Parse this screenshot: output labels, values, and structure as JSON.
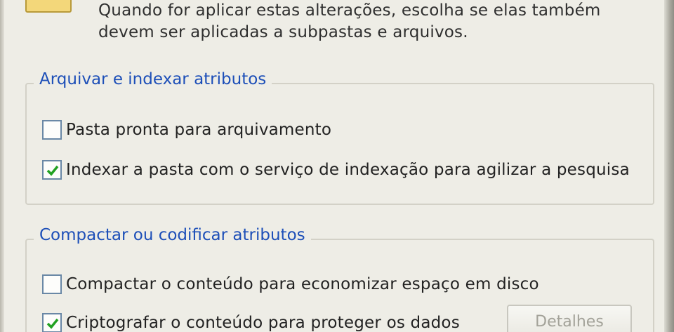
{
  "intro": {
    "line1": "Quando for aplicar estas alterações, escolha se elas também",
    "line2": "devem ser aplicadas a subpastas e arquivos."
  },
  "archive_group": {
    "legend": "Arquivar e indexar atributos",
    "options": [
      {
        "label": "Pasta pronta para arquivamento",
        "checked": false
      },
      {
        "label": "Indexar a pasta com o serviço de indexação para agilizar a pesquisa",
        "checked": true
      }
    ]
  },
  "compress_group": {
    "legend": "Compactar ou codificar atributos",
    "options": [
      {
        "label": "Compactar o conteúdo para economizar espaço em disco",
        "checked": false
      },
      {
        "label": "Criptografar o conteúdo para proteger os dados",
        "checked": true
      }
    ],
    "details_button": "Detalhes",
    "details_enabled": false
  },
  "colors": {
    "legend_text": "#1d4fb8",
    "checkmark": "#21a121"
  }
}
